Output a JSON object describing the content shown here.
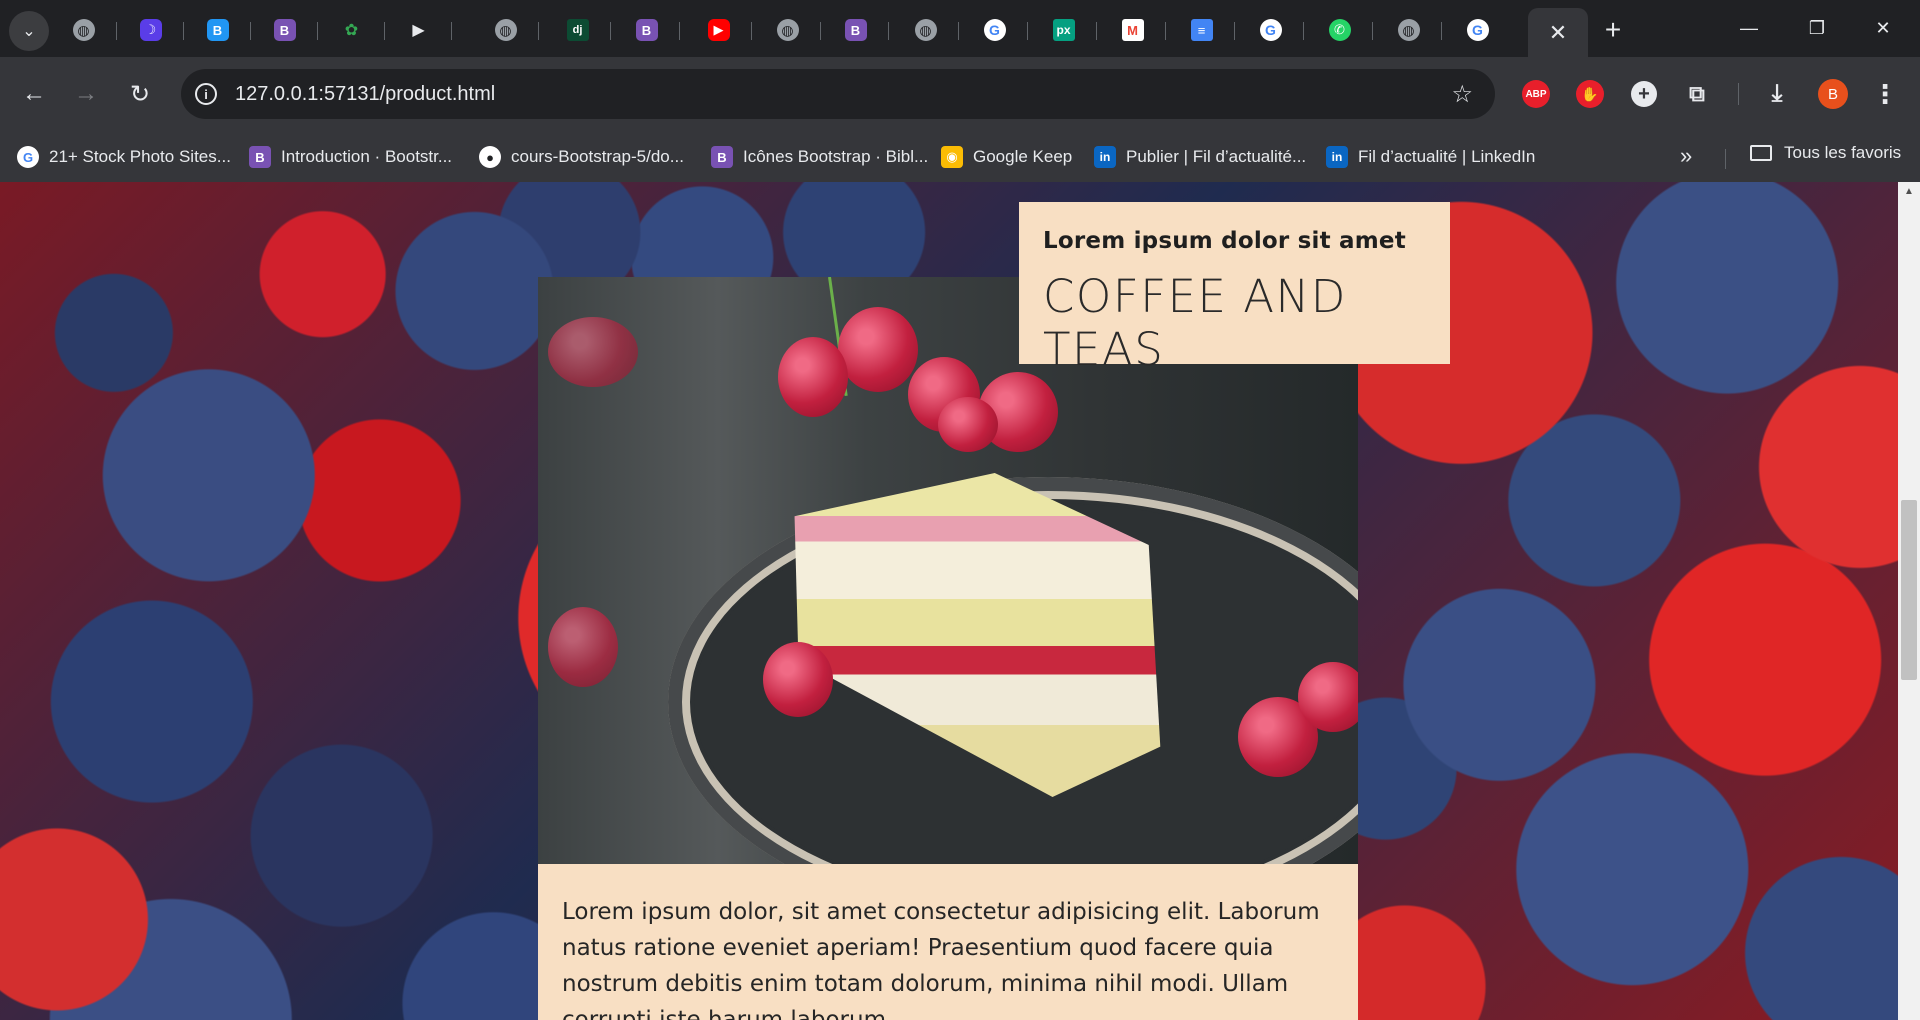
{
  "browser": {
    "address": {
      "url": "127.0.0.1:57131/product.html"
    },
    "tabs": [
      {
        "icon": "globe-icon",
        "glyph": "◍"
      },
      {
        "icon": "moon-app-icon",
        "glyph": "☽"
      },
      {
        "icon": "bootstrap-blue-icon",
        "glyph": "B"
      },
      {
        "icon": "bootstrap-icon",
        "glyph": "B"
      },
      {
        "icon": "leaf-icon",
        "glyph": "✿"
      },
      {
        "icon": "play-icon",
        "glyph": "▶"
      },
      {
        "icon": "globe-icon",
        "glyph": "◍"
      },
      {
        "icon": "django-icon",
        "glyph": "dj"
      },
      {
        "icon": "bootstrap-icon",
        "glyph": "B"
      },
      {
        "icon": "youtube-icon",
        "glyph": "▶"
      },
      {
        "icon": "globe-icon",
        "glyph": "◍"
      },
      {
        "icon": "bootstrap-icon",
        "glyph": "B"
      },
      {
        "icon": "globe-icon",
        "glyph": "◍"
      },
      {
        "icon": "google-icon",
        "glyph": "G"
      },
      {
        "icon": "pixlr-icon",
        "glyph": "px"
      },
      {
        "icon": "gmail-icon",
        "glyph": "M"
      },
      {
        "icon": "docs-icon",
        "glyph": "≡"
      },
      {
        "icon": "google-icon",
        "glyph": "G"
      },
      {
        "icon": "whatsapp-icon",
        "glyph": "✆"
      },
      {
        "icon": "globe-icon",
        "glyph": "◍"
      },
      {
        "icon": "google-icon",
        "glyph": "G"
      }
    ],
    "extensions": {
      "abp_label": "ABP",
      "avatar_initial": "B"
    },
    "bookmarks": [
      {
        "label": "21+ Stock Photo Sites...",
        "icon": "google-icon",
        "glyph": "G"
      },
      {
        "label": "Introduction · Bootstr...",
        "icon": "bootstrap-icon",
        "glyph": "B"
      },
      {
        "label": "cours-Bootstrap-5/do...",
        "icon": "github-icon",
        "glyph": "●"
      },
      {
        "label": "Icônes Bootstrap · Bibl...",
        "icon": "bootstrap-icon",
        "glyph": "B"
      },
      {
        "label": "Google Keep",
        "icon": "keep-icon",
        "glyph": "◉"
      },
      {
        "label": "Publier | Fil d’actualité...",
        "icon": "linkedin-icon",
        "glyph": "in"
      },
      {
        "label": "Fil d’actualité | LinkedIn",
        "icon": "linkedin-icon",
        "glyph": "in"
      }
    ],
    "all_bookmarks_label": "Tous les favoris"
  },
  "page": {
    "card": {
      "subtitle": "Lorem ipsum dolor sit amet",
      "title": "COFFEE AND TEAS",
      "body": "Lorem ipsum dolor, sit amet consectetur adipisicing elit. Laborum natus ratione eveniet aperiam! Praesentium quod facere quia nostrum debitis enim totam dolorum, minima nihil modi. Ullam corrupti iste harum laborum."
    }
  },
  "colors": {
    "chrome_dark": "#202124",
    "chrome_toolbar": "#35363a",
    "card_bg": "#f8dfc3",
    "text_dark": "#262626"
  }
}
